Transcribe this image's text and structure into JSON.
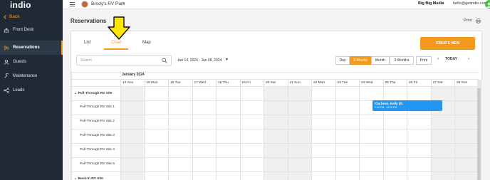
{
  "sidebar": {
    "logo": "indio",
    "back_label": "Back",
    "items": [
      {
        "label": "Front Desk",
        "icon": "front-desk-icon",
        "active": false
      },
      {
        "label": "Reservations",
        "icon": "reservations-icon",
        "active": true
      },
      {
        "label": "Guests",
        "icon": "guests-icon",
        "active": false
      },
      {
        "label": "Maintenance",
        "icon": "maintenance-icon",
        "active": false
      },
      {
        "label": "Leads",
        "icon": "leads-icon",
        "active": false
      }
    ]
  },
  "topbar": {
    "park_name": "Brody's RV Park",
    "company": "Big Big Media",
    "email": "hello@getindio.com"
  },
  "page": {
    "title": "Reservations",
    "print_label": "Print"
  },
  "tabs": [
    {
      "label": "List",
      "active": false
    },
    {
      "label": "Chart",
      "active": true
    },
    {
      "label": "Map",
      "active": false
    }
  ],
  "toolbar": {
    "create_label": "CREATE NEW",
    "search_placeholder": "Search",
    "date_range": "Jan 14, 2024 - Jan 28, 2024",
    "views": [
      {
        "label": "Day",
        "active": false
      },
      {
        "label": "2-Weeks",
        "active": true
      },
      {
        "label": "Month",
        "active": false
      },
      {
        "label": "2-Months",
        "active": false
      }
    ],
    "print_label": "Print",
    "prev_label": "‹",
    "next_label": "›",
    "today_label": "TODAY"
  },
  "calendar": {
    "month": "January 2024",
    "days": [
      "14 Sun",
      "15 Mon",
      "16 Tue",
      "17 Wed",
      "18 Thu",
      "19 Fri",
      "20 Sat",
      "21 Sun",
      "22 Mon",
      "23 Tue",
      "24 Wed",
      "25 Thu",
      "26 Fri",
      "27 Sat",
      "28 Sun"
    ],
    "rows": [
      {
        "label": "Pull-Through RV Site",
        "group": true
      },
      {
        "label": "Pull-Through RV Site 1",
        "group": false
      },
      {
        "label": "Pull-Through RV Site 2",
        "group": false
      },
      {
        "label": "Pull-Through RV Site 3",
        "group": false
      },
      {
        "label": "Pull-Through RV Site 4",
        "group": false
      },
      {
        "label": "Pull-Through RV Site 5",
        "group": false
      },
      {
        "label": "Back-In RV Site",
        "group": true
      }
    ],
    "booking": {
      "name": "Clarkson, Kelly (0)",
      "time": "2:00 PM - 12:00 PM",
      "color": "#2196f3"
    }
  },
  "colors": {
    "accent": "#f39a1e",
    "sidebar_bg": "#1f2a36",
    "booking": "#2196f3",
    "annotation_arrow": "#ffe600"
  }
}
